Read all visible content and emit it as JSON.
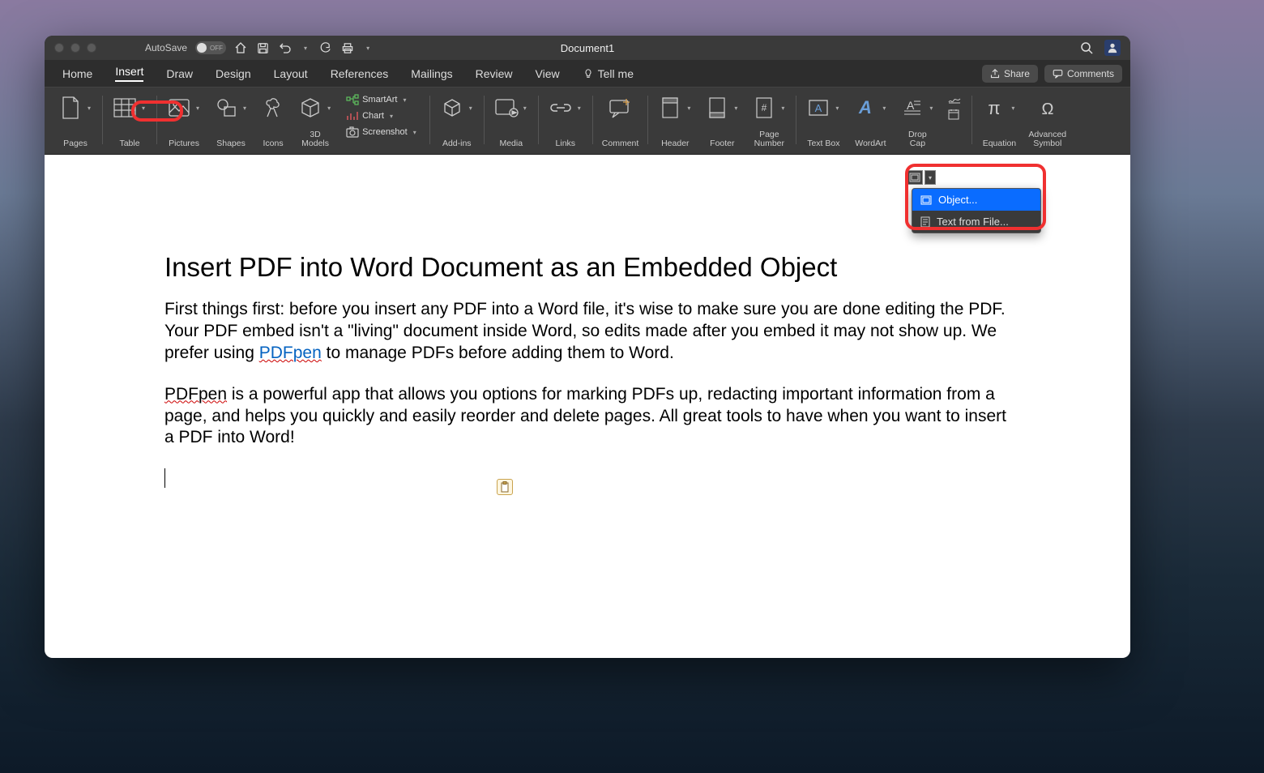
{
  "titlebar": {
    "doc_title": "Document1",
    "autosave_label": "AutoSave",
    "autosave_state": "OFF"
  },
  "tabs": {
    "items": [
      "Home",
      "Insert",
      "Draw",
      "Design",
      "Layout",
      "References",
      "Mailings",
      "Review",
      "View"
    ],
    "active_index": 1,
    "tell_me": "Tell me",
    "share": "Share",
    "comments": "Comments"
  },
  "ribbon": {
    "pages": "Pages",
    "table": "Table",
    "pictures": "Pictures",
    "shapes": "Shapes",
    "icons": "Icons",
    "models": "3D\nModels",
    "smartart": "SmartArt",
    "chart": "Chart",
    "screenshot": "Screenshot",
    "addins": "Add-ins",
    "media": "Media",
    "links": "Links",
    "comment": "Comment",
    "header": "Header",
    "footer": "Footer",
    "pagenum": "Page\nNumber",
    "textbox": "Text Box",
    "wordart": "WordArt",
    "dropcap": "Drop\nCap",
    "equation": "Equation",
    "symbol": "Advanced\nSymbol"
  },
  "popup": {
    "object": "Object...",
    "textfile": "Text from File..."
  },
  "document": {
    "title": "Insert PDF into Word Document as an Embedded Object",
    "p1a": "First things first: before you insert any PDF into a Word file, it's wise to make sure you are done editing the PDF. Your PDF embed isn't a \"living\" document inside Word, so edits made after you embed it may not show up. We prefer using ",
    "p1_link": "PDFpen",
    "p1b": " to manage PDFs before adding them to Word.",
    "p2a": "PDFpen",
    "p2b": " is a powerful app that allows you options for marking PDFs up, redacting important information from a page, and helps you quickly and easily reorder and delete pages. All great tools to have when you want to insert a PDF into Word!"
  }
}
